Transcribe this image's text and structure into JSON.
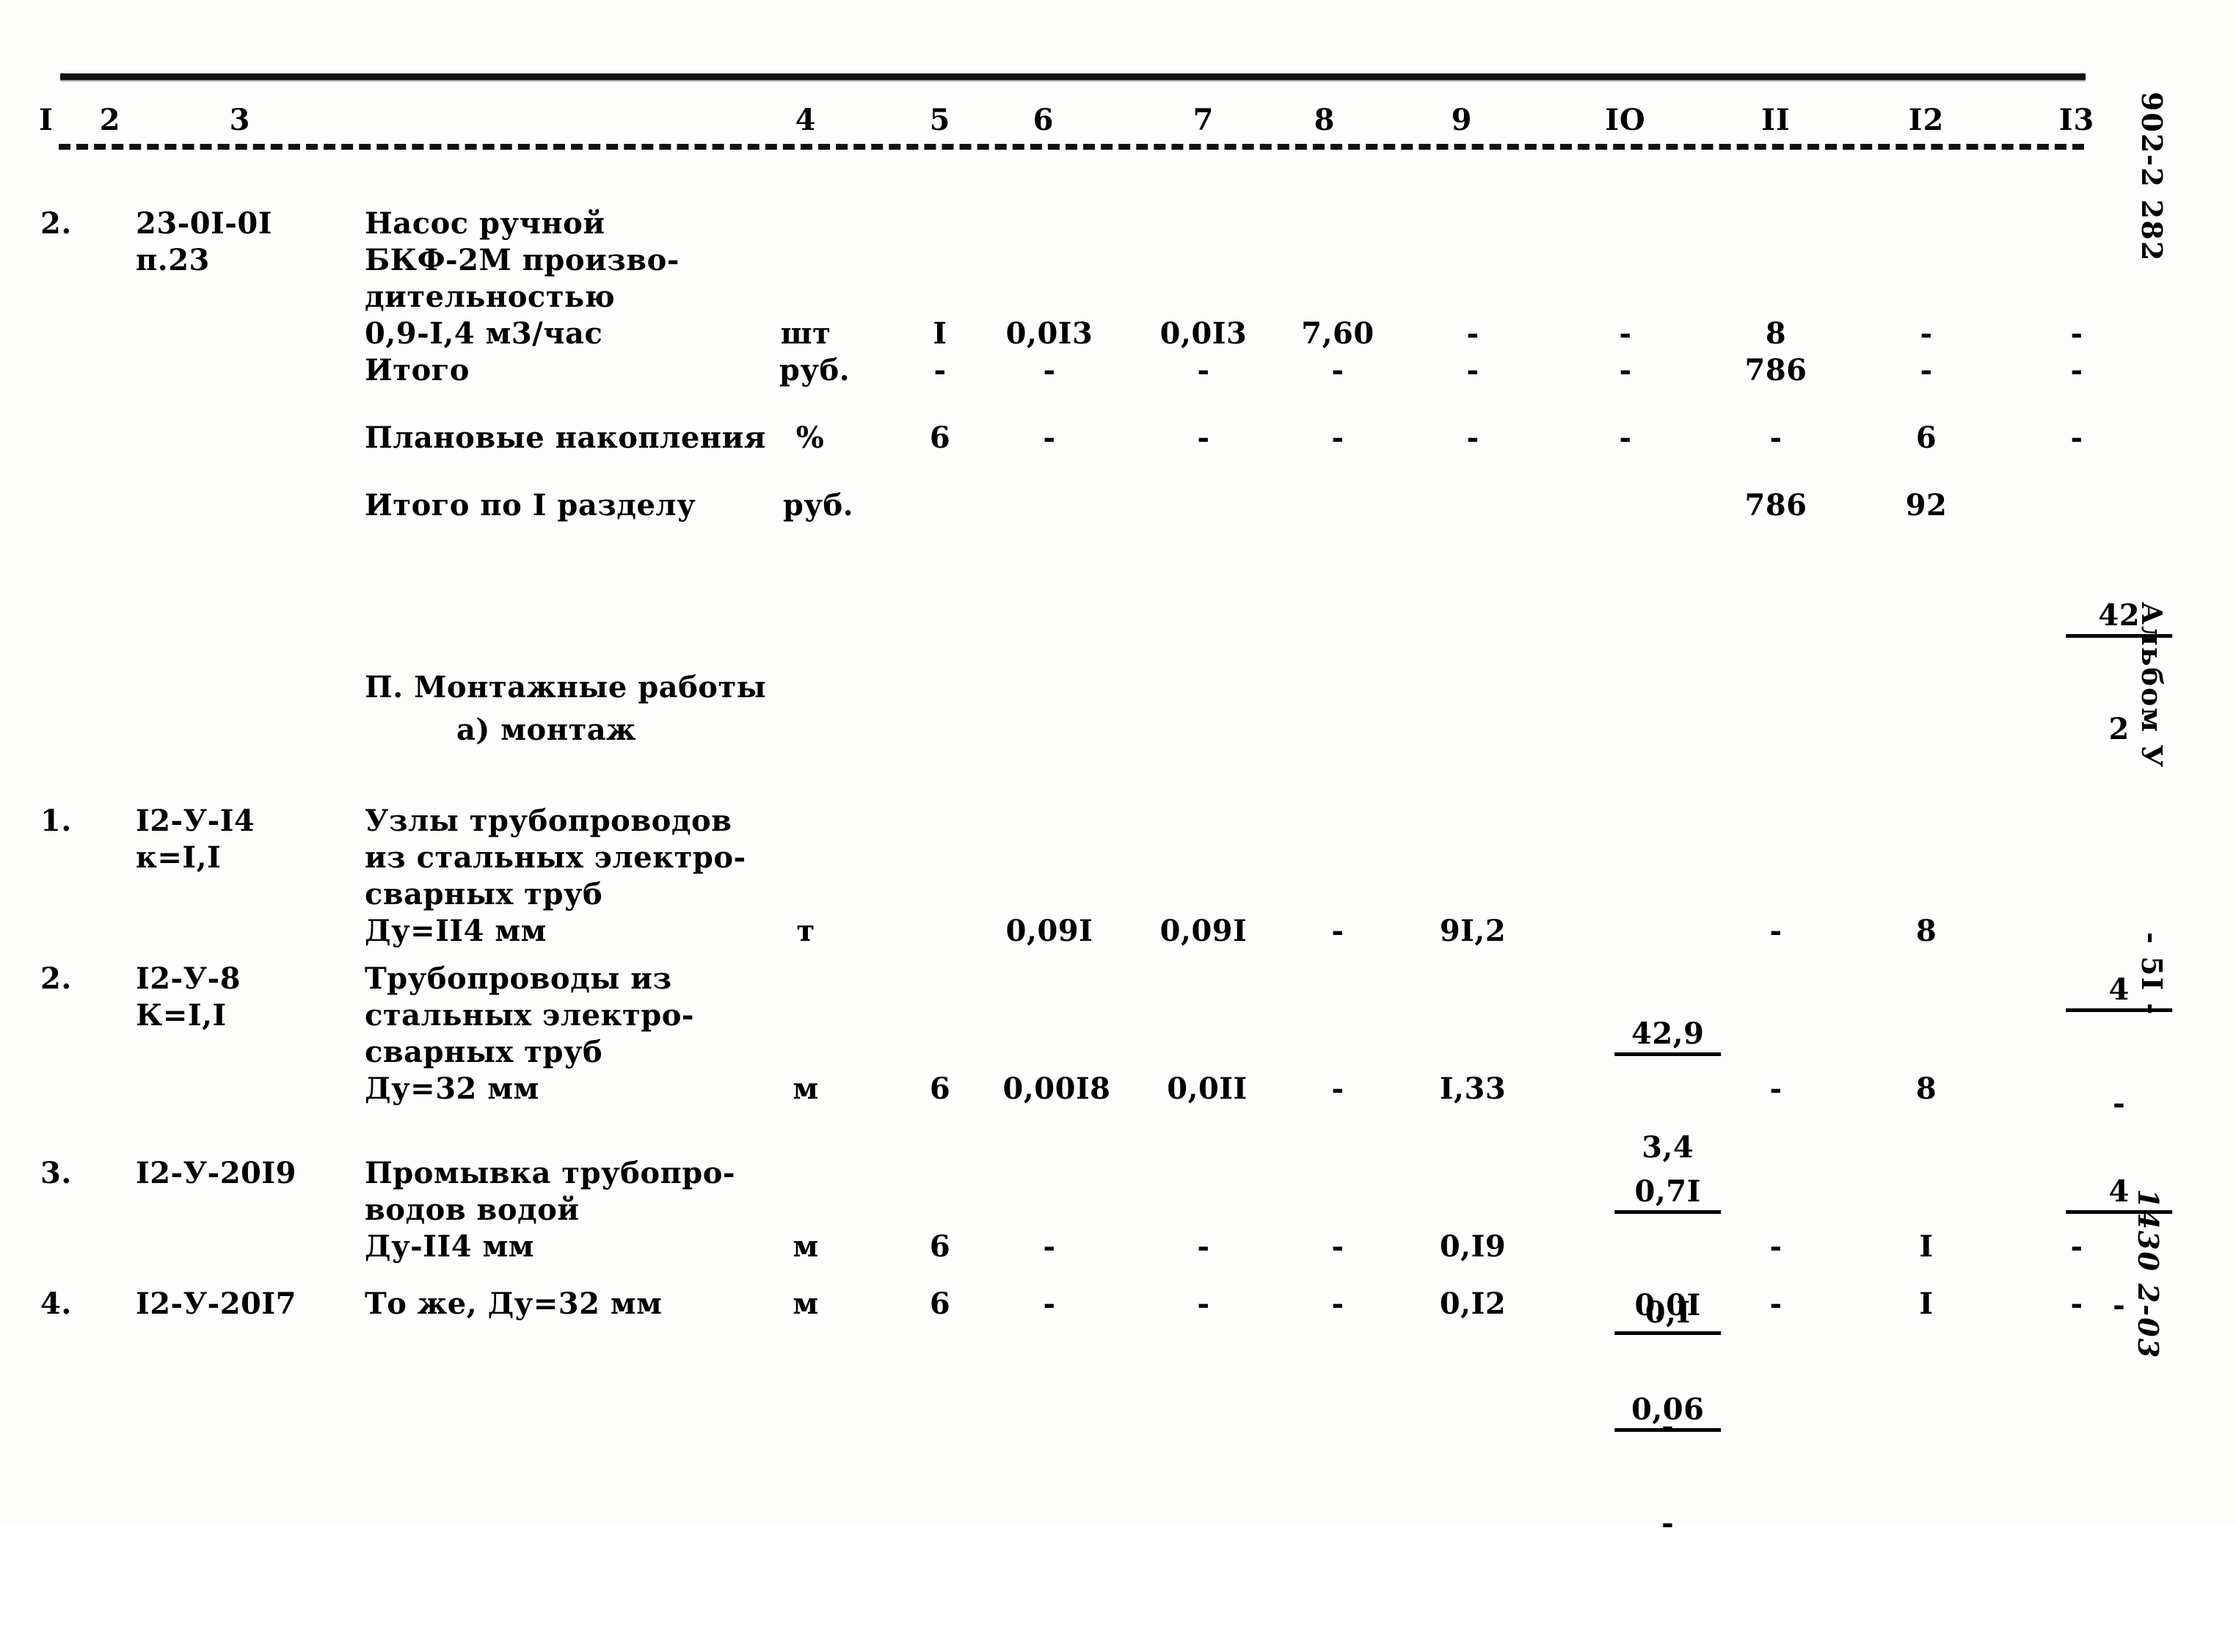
{
  "document": {
    "top_rule": true,
    "column_numbers": [
      "I",
      "2",
      "3",
      "4",
      "5",
      "6",
      "7",
      "8",
      "9",
      "IO",
      "II",
      "I2",
      "I3"
    ]
  },
  "margin_notes": {
    "code_top": "902-2 282",
    "album": "Альбом У",
    "page": "- 5I -",
    "sheet": "1430 2-03"
  },
  "rows": [
    {
      "num": "2.",
      "code": "23-0I-0I\nп.23",
      "desc": "Насос ручной\nБКФ-2М произво-\nдительностью\n0,9-I,4 м3/час",
      "c4": "шт",
      "c5": "I",
      "c6": "0,0I3",
      "c7": "0,0I3",
      "c8": "7,60",
      "c9": "-",
      "c10": "-",
      "c11": "8",
      "c12": "-",
      "c13": "-"
    },
    {
      "num": "",
      "code": "",
      "desc": "Итого",
      "c4": "руб.",
      "c5": "-",
      "c6": "-",
      "c7": "-",
      "c8": "-",
      "c9": "-",
      "c10": "-",
      "c11": "786",
      "c12": "-",
      "c13": "-"
    },
    {
      "num": "",
      "code": "",
      "desc": "Плановые накопления",
      "c4": "%",
      "c5": "6",
      "c6": "-",
      "c7": "-",
      "c8": "-",
      "c9": "-",
      "c10": "-",
      "c11": "-",
      "c12": "6",
      "c13": "-"
    },
    {
      "num": "",
      "code": "",
      "desc": "Итого по I разделу",
      "c4": "руб.",
      "c5": "",
      "c6": "",
      "c7": "",
      "c8": "",
      "c9": "",
      "c10": "",
      "c11": "786",
      "c12": "92",
      "c13_num": "42",
      "c13_den": "2"
    },
    {
      "num": "1.",
      "code": "I2-У-I4\nк=I,I",
      "desc": "Узлы трубопроводов\nиз стальных электро-\nсварных труб\nДу=II4 мм",
      "c4": "т",
      "c5": "",
      "c6": "0,09I",
      "c7": "0,09I",
      "c8": "-",
      "c9": "9I,2",
      "c10_num": "42,9",
      "c10_den": "3,4",
      "c11": "-",
      "c12": "8",
      "c13_num": "4",
      "c13_den": "-"
    },
    {
      "num": "2.",
      "code": "I2-У-8\nК=I,I",
      "desc": "Трубопроводы из\nстальных электро-\nсварных труб\nДу=32 мм",
      "c4": "м",
      "c5": "6",
      "c6": "0,00I8",
      "c7": "0,0II",
      "c8": "-",
      "c9": "I,33",
      "c10_num": "0,7I",
      "c10_den": "0,0I",
      "c11": "-",
      "c12": "8",
      "c13_num": "4",
      "c13_den": "-"
    },
    {
      "num": "3.",
      "code": "I2-У-20I9",
      "desc": "Промывка трубопро-\nводов водой\nДу-II4 мм",
      "c4": "м",
      "c5": "6",
      "c6": "-",
      "c7": "-",
      "c8": "-",
      "c9": "0,I9",
      "c10_num": "0,I",
      "c10_den": "-",
      "c11": "-",
      "c12": "I",
      "c13": "-"
    },
    {
      "num": "4.",
      "code": "I2-У-20I7",
      "desc": "То же, Ду=32 мм",
      "c4": "м",
      "c5": "6",
      "c6": "-",
      "c7": "-",
      "c8": "-",
      "c9": "0,I2",
      "c10_num": "0,06",
      "c10_den": "-",
      "c11": "-",
      "c12": "I",
      "c13": "-"
    }
  ],
  "section_heading": {
    "line1": "П. Монтажные работы",
    "line2": "а) монтаж"
  }
}
